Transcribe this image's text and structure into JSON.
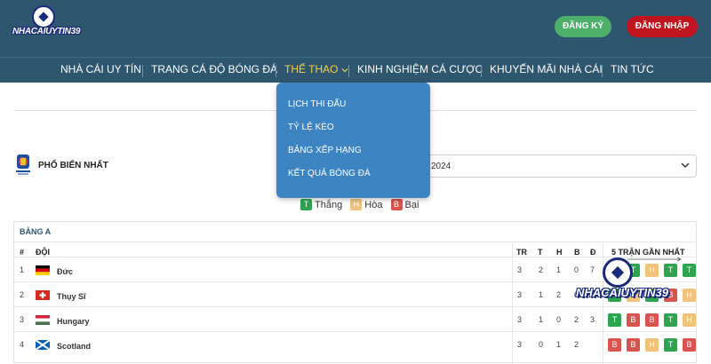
{
  "header": {
    "logo_text": "NHACAIUYTIN39",
    "register_label": "ĐĂNG KÝ",
    "login_label": "ĐĂNG NHẬP"
  },
  "nav": {
    "items": [
      {
        "label": "NHÀ CÁI UY TÍN"
      },
      {
        "label": "TRANG CÁ ĐỘ BÓNG ĐÁ"
      },
      {
        "label": "THỂ THAO"
      },
      {
        "label": "KINH NGHIỆM CÁ CƯỢC"
      },
      {
        "label": "KHUYẾN MÃI NHÀ CÁI"
      },
      {
        "label": "TIN TỨC"
      }
    ],
    "active_color": "#f2d04a"
  },
  "dropdown": {
    "items": [
      {
        "label": "LỊCH THI ĐẤU"
      },
      {
        "label": "TỶ LỆ KÈO"
      },
      {
        "label": "BẢNG XẾP HẠNG"
      },
      {
        "label": "KẾT QUẢ BÓNG ĐÁ"
      }
    ]
  },
  "filters": {
    "popular_label": "PHỔ BIẾN NHẤT",
    "select_value": "2024"
  },
  "legend": {
    "win_badge": "T",
    "win_label": "Thắng",
    "draw_badge": "H",
    "draw_label": "Hòa",
    "loss_badge": "B",
    "loss_label": "Bại"
  },
  "table": {
    "group": "BẢNG A",
    "headers": {
      "rank": "#",
      "team": "ĐỘI",
      "played": "TR",
      "won": "T",
      "drawn": "H",
      "lost": "B",
      "diff": "Đ",
      "form": "5 TRẬN GẦN NHẤT"
    },
    "rows": [
      {
        "rank": "1",
        "team": "Đức",
        "played": "3",
        "won": "2",
        "drawn": "1",
        "lost": "0",
        "diff": "7",
        "form": [
          "T",
          "T",
          "H",
          "T",
          "T"
        ]
      },
      {
        "rank": "2",
        "team": "Thụy Sĩ",
        "played": "3",
        "won": "1",
        "drawn": "2",
        "lost": "0",
        "diff": "",
        "form": [
          "T",
          "H",
          "T",
          "B",
          "H"
        ]
      },
      {
        "rank": "3",
        "team": "Hungary",
        "played": "3",
        "won": "1",
        "drawn": "0",
        "lost": "2",
        "diff": "3",
        "form": [
          "T",
          "B",
          "B",
          "T",
          "H"
        ]
      },
      {
        "rank": "4",
        "team": "Scotland",
        "played": "3",
        "won": "0",
        "drawn": "1",
        "lost": "2",
        "diff": "",
        "form": [
          "B",
          "B",
          "H",
          "T",
          "B"
        ]
      }
    ]
  },
  "watermark_text": "NHACAIUYTIN39",
  "colors": {
    "win": "#2ea44f",
    "draw": "#f0c27a",
    "loss": "#d9534f",
    "header_bg": "#2f566f",
    "dropdown_bg": "#3d84c3"
  }
}
